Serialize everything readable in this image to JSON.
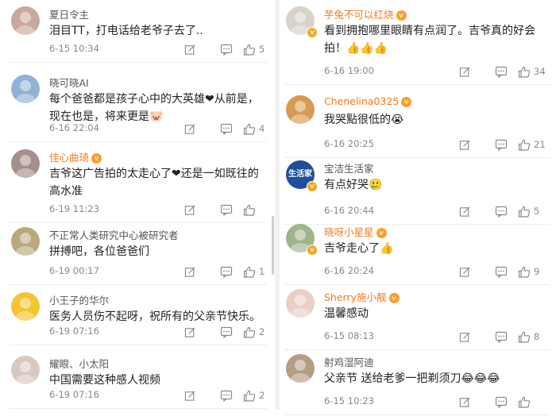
{
  "left_comments": [
    {
      "user": "夏日令主",
      "text": "泪目TT，打电话给老爷子去了..",
      "time": "6-15 10:34",
      "likes": "5",
      "vip": false,
      "verified": false,
      "avatar_color": "#c9a99a"
    },
    {
      "user": "晓可晓AI",
      "text": "每个爸爸都是孩子心中的大英雄❤从前是，现在也是，将来更是🐷",
      "time": "6-16 22:04",
      "likes": "4",
      "vip": false,
      "verified": false,
      "avatar_color": "#8fb2d6"
    },
    {
      "user": "佳心曲琦",
      "text": "吉爷这广告拍的太走心了❤还是一如既往的高水准",
      "time": "6-19 11:23",
      "likes": "",
      "vip": true,
      "verified": false,
      "avatar_color": "#a78e8a"
    },
    {
      "user": "不正常人类研究中心被研究者",
      "text": "拼搏吧，各位爸爸们",
      "time": "6-19 00:17",
      "likes": "1",
      "vip": false,
      "verified": false,
      "avatar_color": "#b8a87b"
    },
    {
      "user": "小王子的华尔",
      "text": "医务人员伤不起呀，祝所有的父亲节快乐。",
      "time": "6-19 07:16",
      "likes": "2",
      "vip": false,
      "verified": false,
      "avatar_color": "#f2c531"
    },
    {
      "user": "耀眼、小太阳",
      "text": "中国需要这种感人视频",
      "time": "6-19 07:16",
      "likes": "2",
      "vip": false,
      "verified": false,
      "avatar_color": "#d9c8c0"
    }
  ],
  "right_comments": [
    {
      "user": "芋兔不可以红烧",
      "text": "看到拥抱哪里眼睛有点润了。吉爷真的好会拍！👍👍👍",
      "time": "6-16 19:00",
      "likes": "34",
      "vip": true,
      "verified": true,
      "avatar_color": "#d8d2c8"
    },
    {
      "user": "Chenelina0325",
      "text": "我哭點很低的😭",
      "time": "6-16 20:25",
      "likes": "21",
      "vip": true,
      "verified": false,
      "avatar_color": "#d89a52"
    },
    {
      "user": "宝洁生活家",
      "text": "有点好哭🥲",
      "time": "6-16 20:44",
      "likes": "5",
      "vip": false,
      "verified": true,
      "avatar_color": "#1f4f9a",
      "avatar_text": "生活家"
    },
    {
      "user": "晓呀小星星",
      "text": "吉爷走心了👍",
      "time": "6-16 20:24",
      "likes": "9",
      "vip": true,
      "verified": true,
      "avatar_color": "#9fb48a"
    },
    {
      "user": "Sherry施小靓",
      "text": "温馨感动",
      "time": "6-15 08:13",
      "likes": "8",
      "vip": true,
      "verified": false,
      "avatar_color": "#e9cfc6"
    },
    {
      "user": "射鸡湿阿迪",
      "text": "父亲节 送给老爹一把剃须刀😂😂😂",
      "time": "6-15 10:23",
      "likes": "",
      "vip": false,
      "verified": false,
      "avatar_color": "#b59c85"
    }
  ]
}
